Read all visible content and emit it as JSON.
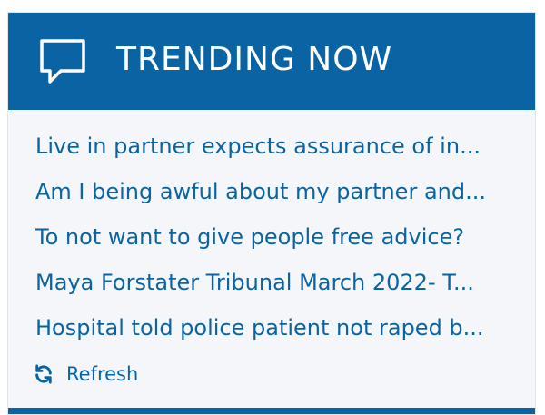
{
  "widget": {
    "title": "TRENDING NOW",
    "header_icon": "speech-bubble-icon",
    "accent_color": "#0a64a3",
    "items": [
      {
        "label": "Live in partner expects assurance of in..."
      },
      {
        "label": "Am I being awful about my partner and..."
      },
      {
        "label": "To not want to give people free advice?"
      },
      {
        "label": "Maya Forstater Tribunal March 2022- T..."
      },
      {
        "label": "Hospital told police patient not raped b..."
      }
    ],
    "refresh": {
      "label": "Refresh",
      "icon": "refresh-icon"
    }
  }
}
